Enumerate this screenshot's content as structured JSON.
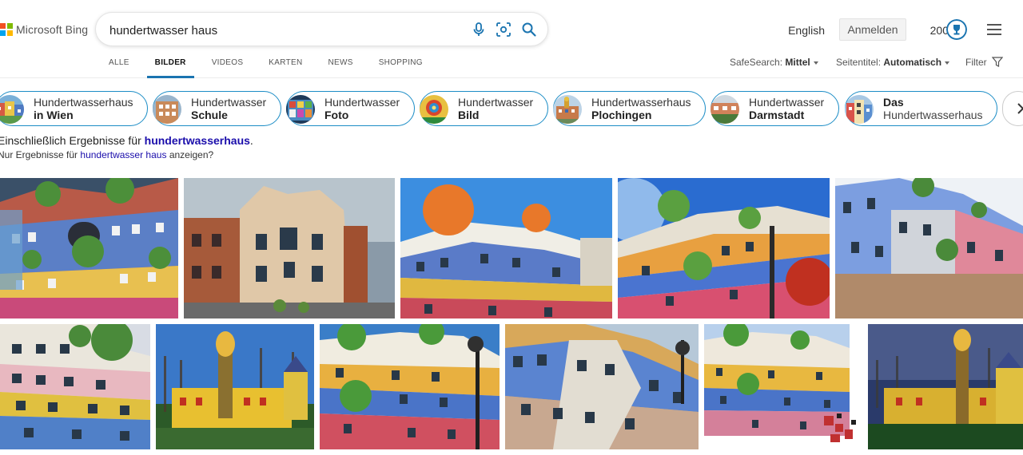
{
  "logo": {
    "text": "Microsoft Bing"
  },
  "search": {
    "query": "hundertwasser haus"
  },
  "header": {
    "language": "English",
    "signin": "Anmelden",
    "points": "200"
  },
  "tabs": [
    "ALLE",
    "BILDER",
    "VIDEOS",
    "KARTEN",
    "NEWS",
    "SHOPPING"
  ],
  "active_tab": "BILDER",
  "filters": {
    "safesearch_label": "SafeSearch:",
    "safesearch_value": "Mittel",
    "pagetitle_label": "Seitentitel:",
    "pagetitle_value": "Automatisch",
    "filter_label": "Filter"
  },
  "chips": [
    {
      "line1": "Hundertwasserhaus",
      "line2": "in Wien"
    },
    {
      "line1": "Hundertwasser",
      "line2": "Schule"
    },
    {
      "line1": "Hundertwasser",
      "line2": "Foto"
    },
    {
      "line1": "Hundertwasser",
      "line2": "Bild"
    },
    {
      "line1": "Hundertwasserhaus",
      "line2": "Plochingen"
    },
    {
      "line1": "Hundertwasser",
      "line2": "Darmstadt"
    },
    {
      "line1": "Das",
      "line2": "Hundertwasserhaus"
    }
  ],
  "spelling": {
    "including_prefix": "Einschließlich Ergebnisse für",
    "corrected_query": "hundertwasserhaus",
    "including_suffix": ".",
    "only_prefix": "Nur Ergebnisse für",
    "original_query": "hundertwasser haus",
    "only_suffix": "anzeigen?"
  },
  "colors": {
    "accent": "#1a74b0",
    "chip_border": "#1c8dc6",
    "link": "#1a0dab"
  },
  "icons": [
    "microphone-icon",
    "visual-search-icon",
    "search-icon",
    "rewards-trophy-icon",
    "hamburger-menu-icon",
    "filter-funnel-icon",
    "chevron-right-icon"
  ]
}
